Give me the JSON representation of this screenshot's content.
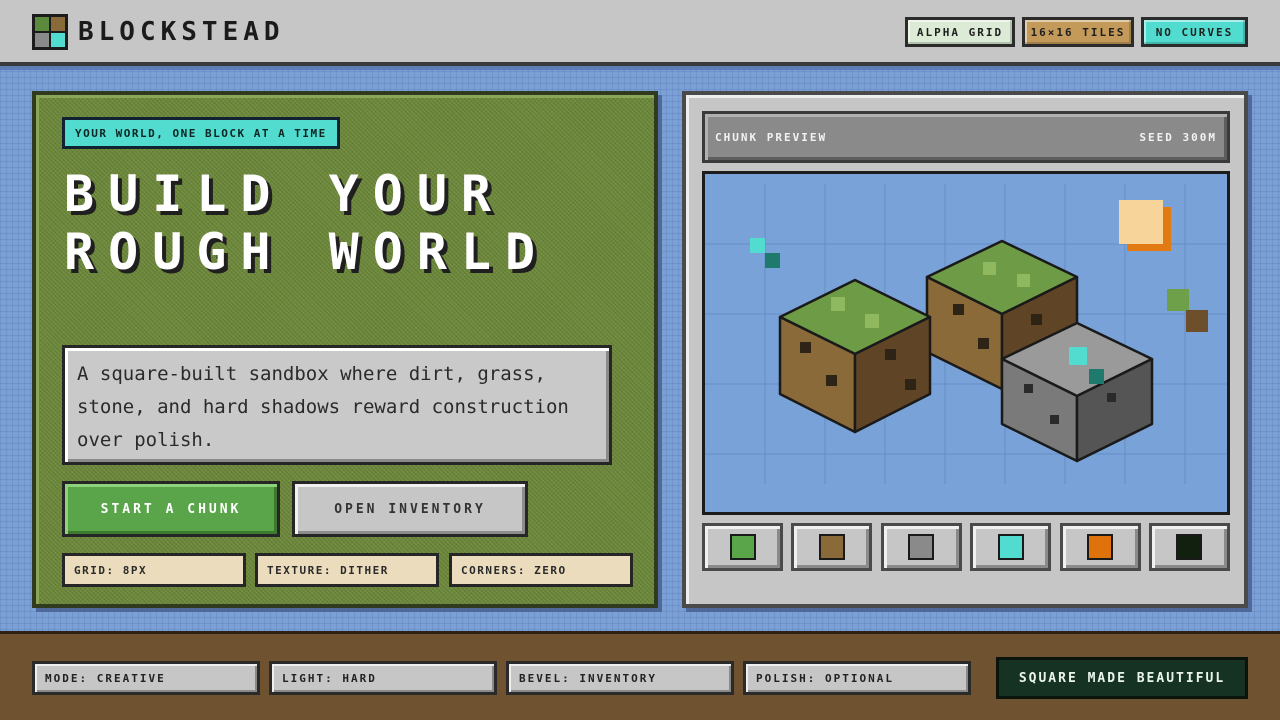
{
  "header": {
    "brand": "BLOCKSTEAD",
    "logo_icon": "grass-block-icon",
    "chips": [
      {
        "label": "ALPHA GRID",
        "color": "#dcebd6"
      },
      {
        "label": "16×16 TILES",
        "color": "#c39a5a"
      },
      {
        "label": "NO CURVES",
        "color": "#52dcd0"
      }
    ]
  },
  "hero": {
    "tagline": "YOUR WORLD, ONE BLOCK AT A TIME",
    "headline": "BUILD YOUR ROUGH WORLD",
    "description": "A square-built sandbox where dirt, grass, stone, and hard shadows reward construction over polish.",
    "start_button": "START A CHUNK",
    "inventory_button": "OPEN INVENTORY",
    "specs": [
      "GRID: 8PX",
      "TEXTURE: DITHER",
      "CORNERS: ZERO"
    ]
  },
  "preview": {
    "title": "CHUNK PREVIEW",
    "seed": "SEED 300M",
    "swatches": [
      {
        "name": "grass",
        "color": "#5aa54a"
      },
      {
        "name": "dirt",
        "color": "#8b6a3a"
      },
      {
        "name": "stone",
        "color": "#8a8a8a"
      },
      {
        "name": "diamond",
        "color": "#52dcd0"
      },
      {
        "name": "lava",
        "color": "#e0720c"
      },
      {
        "name": "obsidian",
        "color": "#12200f"
      }
    ]
  },
  "footer": {
    "stats": [
      "MODE: CREATIVE",
      "LIGHT: HARD",
      "BEVEL: INVENTORY",
      "POLISH: OPTIONAL"
    ],
    "motto": "SQUARE MADE BEAUTIFUL"
  },
  "colors": {
    "sky": "#78a2d8",
    "grass": "#6e9b45",
    "dirt": "#8b6a3a",
    "stone": "#7f7f7f"
  }
}
